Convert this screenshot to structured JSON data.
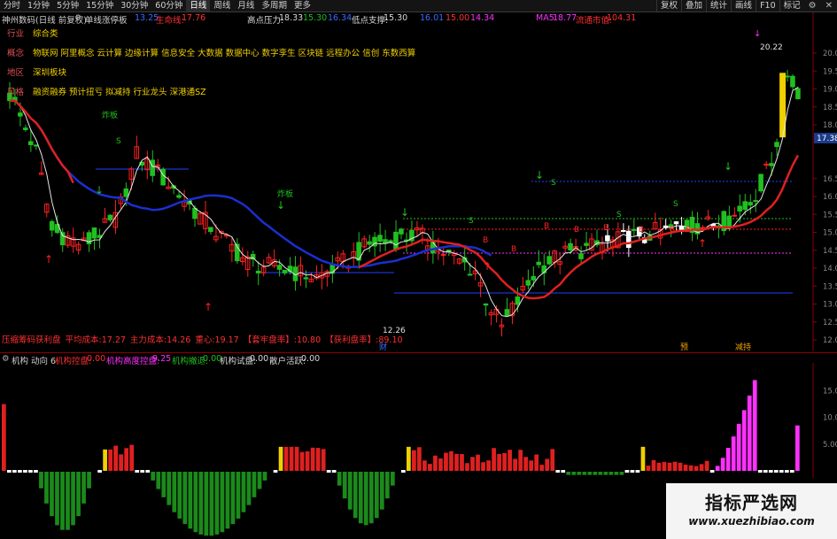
{
  "toolbar": {
    "periods": [
      "分时",
      "1分钟",
      "5分钟",
      "15分钟",
      "30分钟",
      "60分钟",
      "日线",
      "周线",
      "月线",
      "多周期",
      "更多"
    ],
    "active_period": "日线",
    "right_buttons": [
      "复权",
      "叠加",
      "统计",
      "画线",
      "F10",
      "标记"
    ],
    "icons": [
      "settings-icon",
      "close-icon"
    ]
  },
  "infobar": {
    "stock": "神州数码(日线 前复权)",
    "indicator": "单线涨停板",
    "v1": "13.25",
    "lifeline_label": "生命线:",
    "lifeline_value": "17.76",
    "high_label": "高点压力:",
    "high_v1": "18.33",
    "high_v2": "15.30",
    "high_v3": "16.34",
    "low_label": "低点支撑:",
    "low_v1": "15.30",
    "low_v2": "16.01",
    "low_v3": "15.00",
    "low_v4": "14.34",
    "ma5_label": "MA5:",
    "ma5_value": "18.77",
    "mktcap_label": "流通市值:",
    "mktcap_value": "104.31"
  },
  "tags": [
    {
      "key": "行业",
      "value": "综合类"
    },
    {
      "key": "概念",
      "value": "物联网 阿里概念 云计算 边缘计算 信息安全 大数据 数据中心 数字孪生 区块链 远程办公 信创 东数西算"
    },
    {
      "key": "地区",
      "value": "深圳板块"
    },
    {
      "key": "风格",
      "value": "融资融券 预计扭亏 拟减持 行业龙头 深港通SZ"
    }
  ],
  "stats": {
    "label_main": "压缩筹码获利盘",
    "avg_cost_label": "平均成本:",
    "avg_cost": "17.27",
    "main_cost_label": "主力成本:",
    "main_cost": "14.26",
    "center_label": "重心:",
    "center": "19.17",
    "trap_label": "【套牢盘率】:",
    "trap": "10.80",
    "profit_label": "【获利盘率】:",
    "profit": "89.10"
  },
  "price_labels": {
    "peak": "20.22",
    "trough": "12.26"
  },
  "markers": {
    "cai": "财",
    "yu": "预",
    "jian": "减持",
    "zha": "炸板",
    "S": "S",
    "B": "B"
  },
  "price_axis": [
    "20.0",
    "19.0",
    "18.0",
    "17.38",
    "16.0",
    "15.0",
    "14.0",
    "13.0",
    "12.0"
  ],
  "current_price": "17.38",
  "sub": {
    "title": "机构 动向 6",
    "inst_ctrl_label": "机构控盘:",
    "inst_ctrl": "0.00",
    "inst_high_label": "机构高度控盘:",
    "inst_high": "9.25",
    "inst_exit_label": "机构撤退:",
    "inst_exit": "0.00",
    "inst_test_label": "机构试盘:",
    "inst_test": "0.00",
    "retail_label": "散户活跃:",
    "retail": "0.00",
    "axis": [
      "15.0",
      "10.0",
      "5.00"
    ]
  },
  "watermark": {
    "cn": "指标严选网",
    "url": "www.xuezhibiao.com"
  },
  "colors": {
    "up": "#ff2020",
    "down": "#20c020",
    "white": "#ffffff",
    "yellow": "#f0d000",
    "magenta": "#ff30ff",
    "blue": "#1a2fd0",
    "red_line": "#e02020",
    "dark_green": "#1b8a1b"
  }
}
